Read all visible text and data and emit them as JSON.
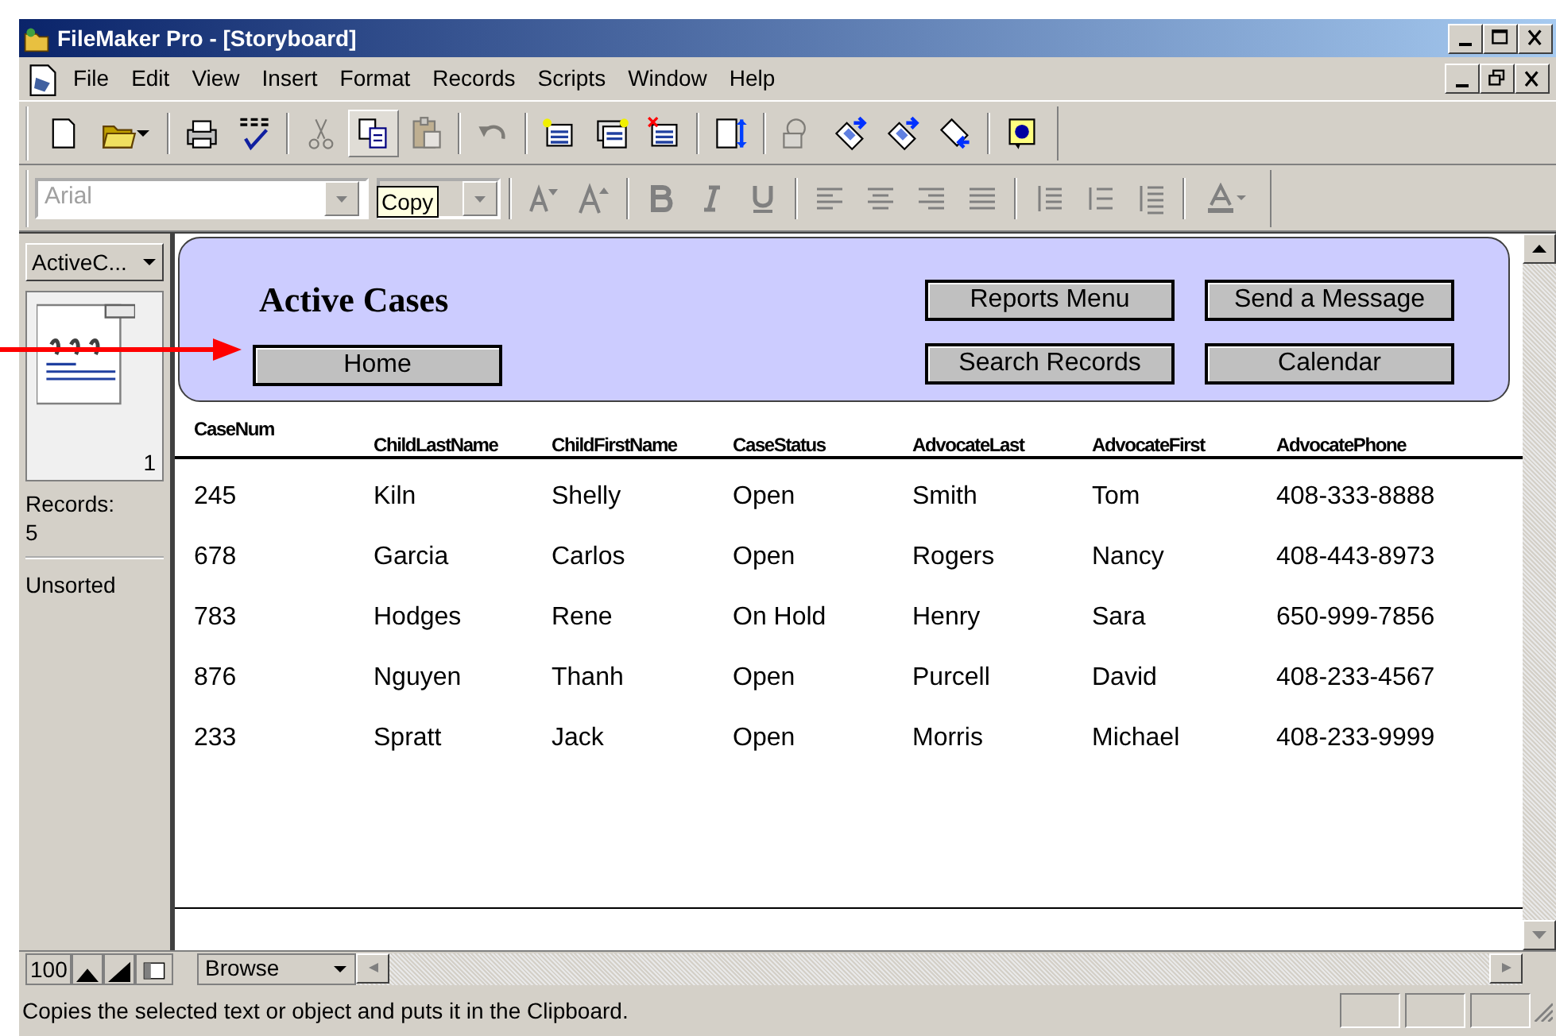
{
  "window": {
    "title": "FileMaker Pro - [Storyboard]"
  },
  "window_controls": [
    {
      "kind": "minimize"
    },
    {
      "kind": "maximize"
    },
    {
      "kind": "close"
    }
  ],
  "menu": [
    "File",
    "Edit",
    "View",
    "Insert",
    "Format",
    "Records",
    "Scripts",
    "Window",
    "Help"
  ],
  "document_controls": [
    {
      "kind": "minimize"
    },
    {
      "kind": "restore"
    },
    {
      "kind": "close"
    }
  ],
  "toolbar": [
    {
      "kind": "new",
      "disabled": false,
      "hovered": false
    },
    {
      "kind": "open",
      "disabled": false,
      "hovered": false
    },
    {
      "kind": "separator"
    },
    {
      "kind": "print",
      "disabled": false,
      "hovered": false
    },
    {
      "kind": "spelling",
      "disabled": false,
      "hovered": false
    },
    {
      "kind": "separator"
    },
    {
      "kind": "cut",
      "disabled": true,
      "hovered": false
    },
    {
      "kind": "copy",
      "disabled": false,
      "hovered": true
    },
    {
      "kind": "paste",
      "disabled": true,
      "hovered": false
    },
    {
      "kind": "separator"
    },
    {
      "kind": "undo",
      "disabled": true,
      "hovered": false
    },
    {
      "kind": "separator"
    },
    {
      "kind": "new-record",
      "disabled": false,
      "hovered": false
    },
    {
      "kind": "duplicate-record",
      "disabled": false,
      "hovered": false
    },
    {
      "kind": "delete-record",
      "disabled": false,
      "hovered": false
    },
    {
      "kind": "separator"
    },
    {
      "kind": "sort",
      "disabled": false,
      "hovered": false
    },
    {
      "kind": "separator"
    },
    {
      "kind": "relationships",
      "disabled": true,
      "hovered": false
    },
    {
      "kind": "import",
      "disabled": false,
      "hovered": false
    },
    {
      "kind": "export",
      "disabled": false,
      "hovered": false
    },
    {
      "kind": "exchange",
      "disabled": false,
      "hovered": false
    },
    {
      "kind": "separator"
    },
    {
      "kind": "help",
      "disabled": false,
      "hovered": false
    }
  ],
  "format_bar": {
    "font": {
      "value": "Arial",
      "disabled": true
    },
    "items": [
      {
        "kind": "smaller"
      },
      {
        "kind": "larger"
      },
      {
        "kind": "separator"
      },
      {
        "kind": "bold"
      },
      {
        "kind": "italic"
      },
      {
        "kind": "underline"
      },
      {
        "kind": "separator"
      },
      {
        "kind": "align-left"
      },
      {
        "kind": "align-center"
      },
      {
        "kind": "align-right"
      },
      {
        "kind": "justify"
      },
      {
        "kind": "separator"
      },
      {
        "kind": "spacing-single"
      },
      {
        "kind": "spacing-half"
      },
      {
        "kind": "spacing-double"
      },
      {
        "kind": "separator"
      },
      {
        "kind": "text-color"
      }
    ]
  },
  "tooltip": {
    "text": "Copy"
  },
  "status_area": {
    "layout": "ActiveC...",
    "page": "1",
    "records_label": "Records:",
    "records_count": "5",
    "sort_state": "Unsorted"
  },
  "layout_header": {
    "title": "Active Cases",
    "home_button": "Home",
    "buttons": [
      "Reports Menu",
      "Send a Message",
      "Search Records",
      "Calendar"
    ]
  },
  "table": {
    "columns": [
      "CaseNum",
      "ChildLastName",
      "ChildFirstName",
      "CaseStatus",
      "AdvocateLast",
      "AdvocateFirst",
      "AdvocatePhone"
    ],
    "rows": [
      [
        "245",
        "Kiln",
        "Shelly",
        "Open",
        "Smith",
        "Tom",
        "408-333-8888"
      ],
      [
        "678",
        "Garcia",
        "Carlos",
        "Open",
        "Rogers",
        "Nancy",
        "408-443-8973"
      ],
      [
        "783",
        "Hodges",
        "Rene",
        "On Hold",
        "Henry",
        "Sara",
        "650-999-7856"
      ],
      [
        "876",
        "Nguyen",
        "Thanh",
        "Open",
        "Purcell",
        "David",
        "408-233-4567"
      ],
      [
        "233",
        "Spratt",
        "Jack",
        "Open",
        "Morris",
        "Michael",
        "408-233-9999"
      ]
    ]
  },
  "bottom_bar": {
    "zoom": "100",
    "mode": "Browse"
  },
  "status_bar": {
    "text": "Copies the selected text or object and puts it in the Clipboard."
  }
}
